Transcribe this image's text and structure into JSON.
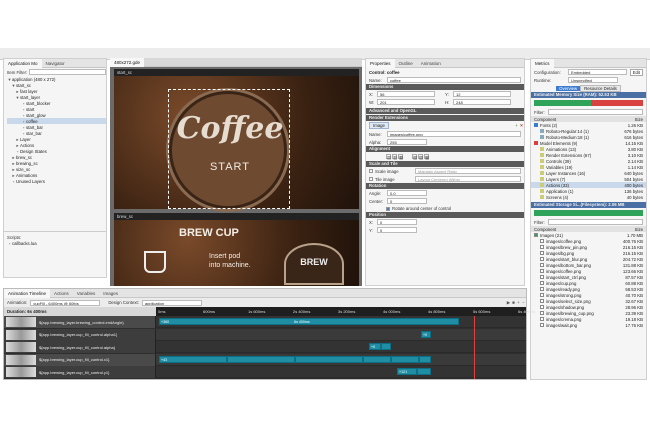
{
  "app_mix": {
    "tab": "Application Mo",
    "tab2": "Navigator",
    "filter_label": "Item Filter:",
    "tree": [
      "application (480 x 272)",
      "start_sc",
      "fast layer",
      "start_layer",
      "start_blocker",
      "start",
      "start_glow",
      "coffee",
      "start_bar",
      "star_bar",
      "Layer",
      "Actions",
      "Design States",
      "brew_sc",
      "brewing_sc",
      "size_sc",
      "Animations",
      "Unused Layers"
    ],
    "scripts_label": "Scripts:",
    "script_file": "callbacks.lua"
  },
  "editor": {
    "tab": "480x272.gde",
    "screen1": "start_sc",
    "screen2": "brew_sc",
    "coffee_text": "Coffee",
    "start_text": "START",
    "brew_title": "BREW CUP",
    "brew_caption_1": "Insert pod",
    "brew_caption_2": "into machine.",
    "brew_partial": "BREW"
  },
  "properties": {
    "tabs": [
      "Properties",
      "Outline",
      "Animation"
    ],
    "title": "Control: coffee",
    "name_label": "Name:",
    "name_value": "coffee",
    "sec_dimensions": "Dimensions",
    "x_label": "X:",
    "x_value": "56",
    "y_label": "Y:",
    "y_value": "12",
    "w_label": "W:",
    "w_value": "201",
    "h_label": "H:",
    "h_value": "248",
    "sec_advanced": "Advanced and OpenGL",
    "sec_render": "Render Extensions",
    "image_chip": "Image",
    "img_name_label": "Name:",
    "img_name_value": "images/coffee.png",
    "alpha_label": "Alpha:",
    "alpha_value": "255",
    "sec_alignment": "Alignment",
    "sec_scale": "Scale and Tile",
    "scale_label": "Scale image",
    "scale_value": "Maintain Aspect Ratio",
    "tile_label": "Tile image",
    "tile_value": "Layout Centered Within",
    "sec_rotation": "Rotation",
    "angle_label": "Angle:",
    "angle_value": "0.0",
    "center_label": "Center:",
    "center_value": "0",
    "rotate_label": "Rotate around center of control",
    "sec_position": "Position",
    "px_label": "X:",
    "px_value": "0",
    "py_label": "Y:",
    "py_value": "0"
  },
  "metrics": {
    "tab": "Metrics",
    "config_label": "Configuration:",
    "config_value": "Embedded",
    "edit_label": "Edit",
    "runtime_label": "Runtime:",
    "runtime_value": "Unspecified",
    "view_tabs": [
      "Overview",
      "Resource Details"
    ],
    "mem_header": "Estimated Memory Size (RAM): 52.53 KB",
    "filter_label": "Filter:",
    "col_component": "Component",
    "col_size": "Size",
    "rows": [
      {
        "name": "Fonts (2)",
        "size": "1.26 KB"
      },
      {
        "name": "Roboto-Regular:14 (1)",
        "size": "676 bytes"
      },
      {
        "name": "Roboto-Medium:18 (1)",
        "size": "616 bytes"
      },
      {
        "name": "Model Elements (9)",
        "size": "14.15 KB"
      },
      {
        "name": "Animations (13)",
        "size": "3.80 KB"
      },
      {
        "name": "Render Extensions (67)",
        "size": "3.10 KB"
      },
      {
        "name": "Controls (39)",
        "size": "2.14 KB"
      },
      {
        "name": "Variables (19)",
        "size": "1.14 KB"
      },
      {
        "name": "Layer Instances (16)",
        "size": "640 bytes"
      },
      {
        "name": "Layers (7)",
        "size": "504 bytes"
      },
      {
        "name": "Actions (33)",
        "size": "400 bytes"
      },
      {
        "name": "Application (1)",
        "size": "136 bytes"
      },
      {
        "name": "Screens (4)",
        "size": "40 bytes"
      }
    ],
    "storage_header": "Estimated Storage Si...(Filesystem): 2.06 MB",
    "filter2_label": "Filter:",
    "col_component2": "Component",
    "col_size2": "Size",
    "files": [
      {
        "name": "Images (21)",
        "size": "1.70 MB"
      },
      {
        "name": "images/coffee.png",
        "size": "400.76 KB"
      },
      {
        "name": "images/brew_pin.png",
        "size": "216.15 KB"
      },
      {
        "name": "images/bg.png",
        "size": "216.15 KB"
      },
      {
        "name": "images/start_blur.png",
        "size": "204.72 KB"
      },
      {
        "name": "images/bottom_bar.png",
        "size": "131.88 KB"
      },
      {
        "name": "images/coffee.png",
        "size": "123.66 KB"
      },
      {
        "name": "images/start_ctrl.png",
        "size": "87.57 KB"
      },
      {
        "name": "images/cup.png",
        "size": "60.88 KB"
      },
      {
        "name": "images/ready.png",
        "size": "58.53 KB"
      },
      {
        "name": "images/strong.png",
        "size": "40.70 KB"
      },
      {
        "name": "images/select_size.png",
        "size": "32.67 KB"
      },
      {
        "name": "images/shadow.png",
        "size": "28.96 KB"
      },
      {
        "name": "images/brewing_cup.png",
        "size": "23.39 KB"
      },
      {
        "name": "images/crema.png",
        "size": "19.18 KB"
      },
      {
        "name": "images/wait.png",
        "size": "17.76 KB"
      }
    ]
  },
  "timeline": {
    "tabs": [
      "Animation Timeline",
      "Actions",
      "Variables",
      "Images"
    ],
    "anim_label": "Animation:",
    "anim_value": "cupFill - 6400ms @ 60fps",
    "context_label": "Design Context:",
    "context_value": "application",
    "duration": "Duration: 6s 400ms",
    "ticks": [
      "0ms",
      "600ms",
      "1s 600ms",
      "2s 400ms",
      "3s 200ms",
      "4s 000ms",
      "4s 800ms",
      "5s 600ms",
      "6s 400ms"
    ],
    "tracks": [
      {
        "label": "${app.brewing_layer.brewing_control.endAngle}",
        "badge": "+360",
        "mid": "6s 400ms"
      },
      {
        "label": "${app.brewing_layer.cup_fill_control.alpha1}",
        "badge": "+0"
      },
      {
        "label": "${app.brewing_layer.cup_fill_control.alpha}",
        "badge": "+0"
      },
      {
        "label": "${app.brewing_layer.cup_fill_control.x1}",
        "badge": "+43"
      },
      {
        "label": "${app.brewing_layer.cup_fill_control.y1}",
        "badge": "+121"
      }
    ]
  }
}
